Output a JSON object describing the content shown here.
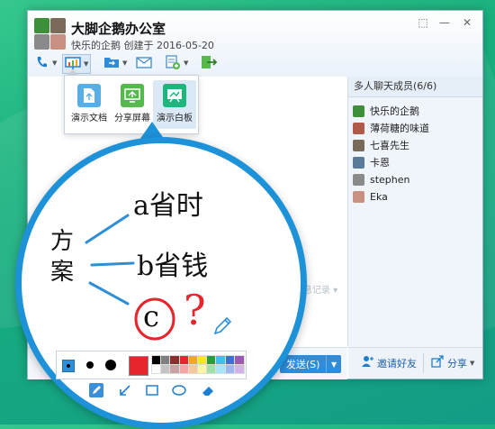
{
  "window": {
    "title": "大脚企鹅办公室",
    "subtitle": "快乐的企鹅 创建于 2016-05-20",
    "controls": [
      "⬚",
      "—",
      "✕"
    ]
  },
  "toolbar": {
    "icons": [
      "phone-icon",
      "presentation-icon",
      "folder-icon",
      "mail-icon",
      "app-add-icon",
      "exit-icon"
    ]
  },
  "popup": {
    "items": [
      {
        "label": "演示文档",
        "icon": "document-icon",
        "color": "#5aaee6"
      },
      {
        "label": "分享屏幕",
        "icon": "screen-share-icon",
        "color": "#56b94d"
      },
      {
        "label": "演示白板",
        "icon": "whiteboard-icon",
        "color": "#1db77d",
        "selected": true
      }
    ]
  },
  "members": {
    "header": "多人聊天成员(6/6)",
    "list": [
      {
        "name": "快乐的企鹅",
        "color": "#3e8f3a"
      },
      {
        "name": "薄荷糖的味道",
        "color": "#b05a4a"
      },
      {
        "name": "七喜先生",
        "color": "#7a6a5a"
      },
      {
        "name": "卡恩",
        "color": "#5a7a9a"
      },
      {
        "name": "stephen",
        "color": "#8a8a8a"
      },
      {
        "name": "Eka",
        "color": "#c89080"
      }
    ],
    "invite_label": "邀请好友",
    "share_label": "分享"
  },
  "chat": {
    "history_label": "消息记录",
    "send_label": "发送(S)"
  },
  "whiteboard": {
    "center_text": "方案",
    "branch_a": "a省时",
    "branch_b": "b省钱",
    "branch_c": "c",
    "question": "?"
  },
  "palette": {
    "current_color": "#e8242c",
    "colors": [
      "#000000",
      "#7f7f7f",
      "#8b2d2d",
      "#e8242c",
      "#f5a623",
      "#f8e71c",
      "#2a9d3c",
      "#3fbfee",
      "#3b6fd8",
      "#9b59b6",
      "#ffffff",
      "#c3c3c3",
      "#c8a2a2",
      "#f4a6a6",
      "#f7c89b",
      "#fdf5a6",
      "#9ee0a8",
      "#a8e4f7",
      "#9fb7ef",
      "#d3b4e6"
    ]
  },
  "draw_tools": [
    "pencil-icon",
    "arrow-icon",
    "rectangle-icon",
    "ellipse-icon",
    "eraser-icon"
  ]
}
